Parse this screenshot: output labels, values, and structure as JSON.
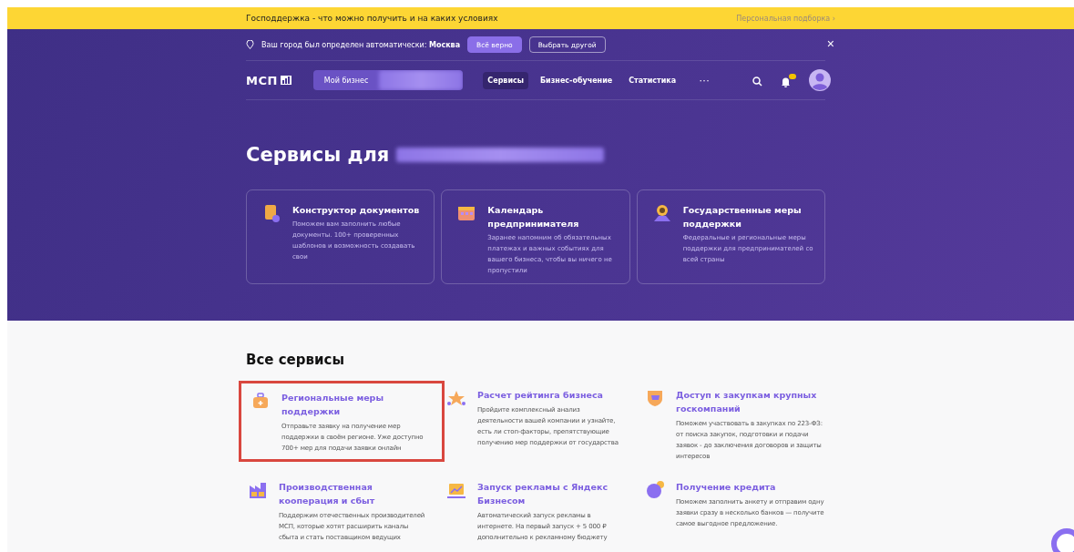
{
  "promo_bar": {
    "text": "Господдержка - что можно получить и на каких условиях",
    "link": "Персональная подборка ›"
  },
  "city_bar": {
    "text": "Ваш город был определен автоматически: **Москва**",
    "buttons": [
      {
        "label": "Всё верно",
        "kind": "primary"
      },
      {
        "label": "Выбрать другой",
        "kind": "outline"
      }
    ],
    "close": "×"
  },
  "header": {
    "logo": "МСП",
    "business_tab": "Мой бизнес",
    "nav": [
      {
        "label": "Сервисы",
        "selected": true
      },
      {
        "label": "Бизнес-обучение",
        "selected": false
      },
      {
        "label": "Статистика",
        "selected": false
      }
    ],
    "more": "···",
    "notifications": true
  },
  "hero": {
    "title": "Сервисы для"
  },
  "featured": [
    {
      "kind": "document",
      "title": "Конструктор документов",
      "text": "Поможем вам заполнить любые документы. 100+ проверенных шаблонов и возможность создавать свои"
    },
    {
      "kind": "calendar",
      "title": "Календарь предпринимателя",
      "text": "Заранее напомним об обязательных платежах и важных событиях для вашего бизнеса, чтобы вы ничего не пропустили"
    },
    {
      "kind": "pin",
      "title": "Государственные меры поддержки",
      "text": "Федеральные и региональные меры поддержки для предпринимателей со всей страны"
    }
  ],
  "all_services": {
    "title": "Все сервисы",
    "items": [
      {
        "kind": "briefcase",
        "title": "Региональные меры поддержки",
        "text": "Отправьте заявку на получение мер поддержки в своём регионе. Уже доступно 700+ мер для подачи заявки онлайн",
        "highlighted": true
      },
      {
        "kind": "stars",
        "title": "Расчет рейтинга бизнеса",
        "text": "Пройдите комплексный анализ деятельности вашей компании и узнайте, есть ли стоп-факторы, препятствующие получению мер поддержки от государства",
        "highlighted": false
      },
      {
        "kind": "shield",
        "title": "Доступ к закупкам крупных госкомпаний",
        "text": "Поможем участвовать в закупках по 223-ФЗ: от поиска закупок, подготовки и подачи заявок - до заключения договоров и защиты интересов",
        "highlighted": false
      },
      {
        "kind": "factory",
        "title": "Производственная кооперация и сбыт",
        "text": "Поддержим отечественных производителей МСП, которые хотят расширить каналы сбыта и стать поставщиком ведущих",
        "highlighted": false
      },
      {
        "kind": "chart",
        "title": "Запуск рекламы с Яндекс Бизнесом",
        "text": "Автоматический запуск рекламы в интернете. На первый запуск + 5 000 ₽ дополнительно к рекламному бюджету",
        "highlighted": false
      },
      {
        "kind": "coins",
        "title": "Получение кредита",
        "text": "Поможем заполнить анкету и отправим одну заявки сразу в несколько банков — получите самое выгодное предложение.",
        "highlighted": false
      }
    ]
  }
}
